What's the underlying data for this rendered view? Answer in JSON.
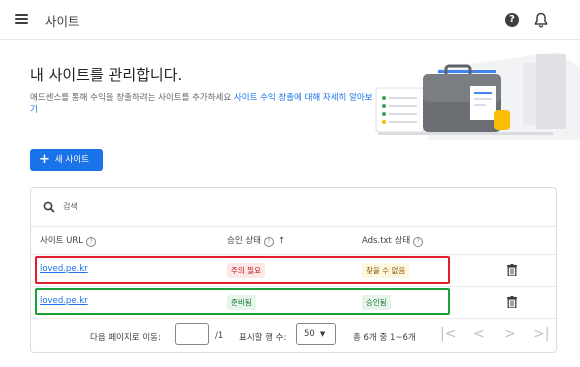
{
  "header": {
    "title": "사이트"
  },
  "intro": {
    "headline": "내 사이트를 관리합니다.",
    "desc_text": "애드센스를 통해 수익을 창출하려는 사이트를 추가하세요 ",
    "desc_link": "사이트 수익 창출에 대해 자세히 알아보기"
  },
  "new_site_button": "새 사이트",
  "search": {
    "placeholder": "검색"
  },
  "table": {
    "headers": {
      "url": "사이트 URL",
      "approval": "승인 상태",
      "ads_txt": "Ads.txt 상태"
    },
    "rows": [
      {
        "url": "loved.pe.kr",
        "approval": "주의 필요",
        "ads_txt": "찾을 수 없음"
      },
      {
        "url": "loved.pe.kr",
        "approval": "준비됨",
        "ads_txt": "승인됨"
      }
    ]
  },
  "pagination": {
    "go_to_label": "다음 페이지로 이동:",
    "total_pages": "/1",
    "rows_label": "표시할 행 수:",
    "rows_value": "50",
    "range": "총 6개 중 1~6개"
  },
  "colors": {
    "accent": "#1a73e8",
    "highlight_red": "#e11d2a",
    "highlight_green": "#1aa33a"
  }
}
